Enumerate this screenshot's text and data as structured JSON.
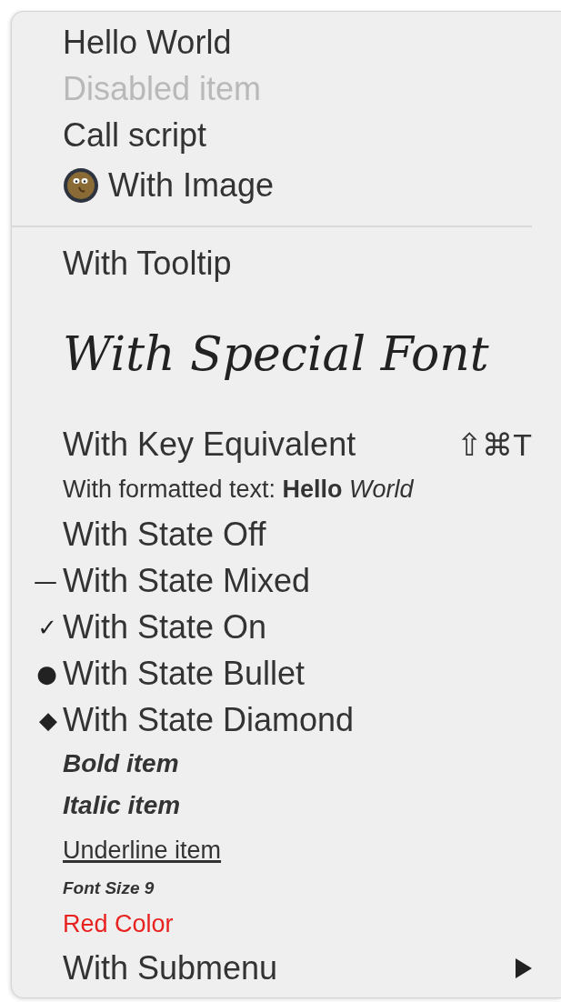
{
  "menu": {
    "items": [
      {
        "kind": "plain",
        "label": "Hello World",
        "disabled": false
      },
      {
        "kind": "plain",
        "label": "Disabled item",
        "disabled": true
      },
      {
        "kind": "plain",
        "label": "Call script",
        "disabled": false
      },
      {
        "kind": "image",
        "label": "With Image",
        "disabled": false
      },
      {
        "kind": "separator"
      },
      {
        "kind": "plain",
        "label": "With Tooltip",
        "disabled": false
      },
      {
        "kind": "special_font",
        "label": "With Special Font",
        "disabled": false
      },
      {
        "kind": "plain",
        "label": "With Key Equivalent",
        "disabled": false,
        "shortcut": "⇧⌘T"
      },
      {
        "kind": "formatted",
        "label": "With formatted text: **Hello** *World*",
        "disabled": false
      },
      {
        "kind": "plain",
        "label": "With State Off",
        "disabled": false
      },
      {
        "kind": "plain",
        "label": "With State Mixed",
        "disabled": false,
        "state_mark": "—"
      },
      {
        "kind": "plain",
        "label": "With State On",
        "disabled": false,
        "state_mark": "✓"
      },
      {
        "kind": "plain",
        "label": "With State Bullet",
        "disabled": false,
        "state_mark": "●"
      },
      {
        "kind": "plain",
        "label": "With State Diamond",
        "disabled": false,
        "state_mark": "◆"
      },
      {
        "kind": "bold",
        "label": "Bold item",
        "disabled": false
      },
      {
        "kind": "italic",
        "label": "Italic item",
        "disabled": false
      },
      {
        "kind": "underline",
        "label": "Underline item",
        "disabled": false
      },
      {
        "kind": "small",
        "label": "Font Size 9",
        "disabled": false
      },
      {
        "kind": "colored",
        "label": "Red Color",
        "disabled": false,
        "color": "#e8221f"
      },
      {
        "kind": "submenu",
        "label": "With Submenu",
        "disabled": false
      }
    ]
  }
}
